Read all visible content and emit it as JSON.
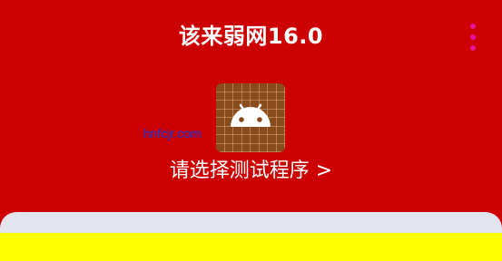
{
  "header": {
    "title": "该来弱网16.0",
    "menu_icon": "more-vertical-icon"
  },
  "app_icon": {
    "icon": "android-robot-icon"
  },
  "watermark": {
    "text": "hnfcjr.com"
  },
  "main": {
    "select_prompt": "请选择测试程序 >"
  },
  "colors": {
    "background": "#cc0000",
    "menu_dots": "#e6139c",
    "icon_tile": "#8a4b1c",
    "bottom_sheet": "#e4e4ee",
    "bottom_band": "#ffff00"
  }
}
